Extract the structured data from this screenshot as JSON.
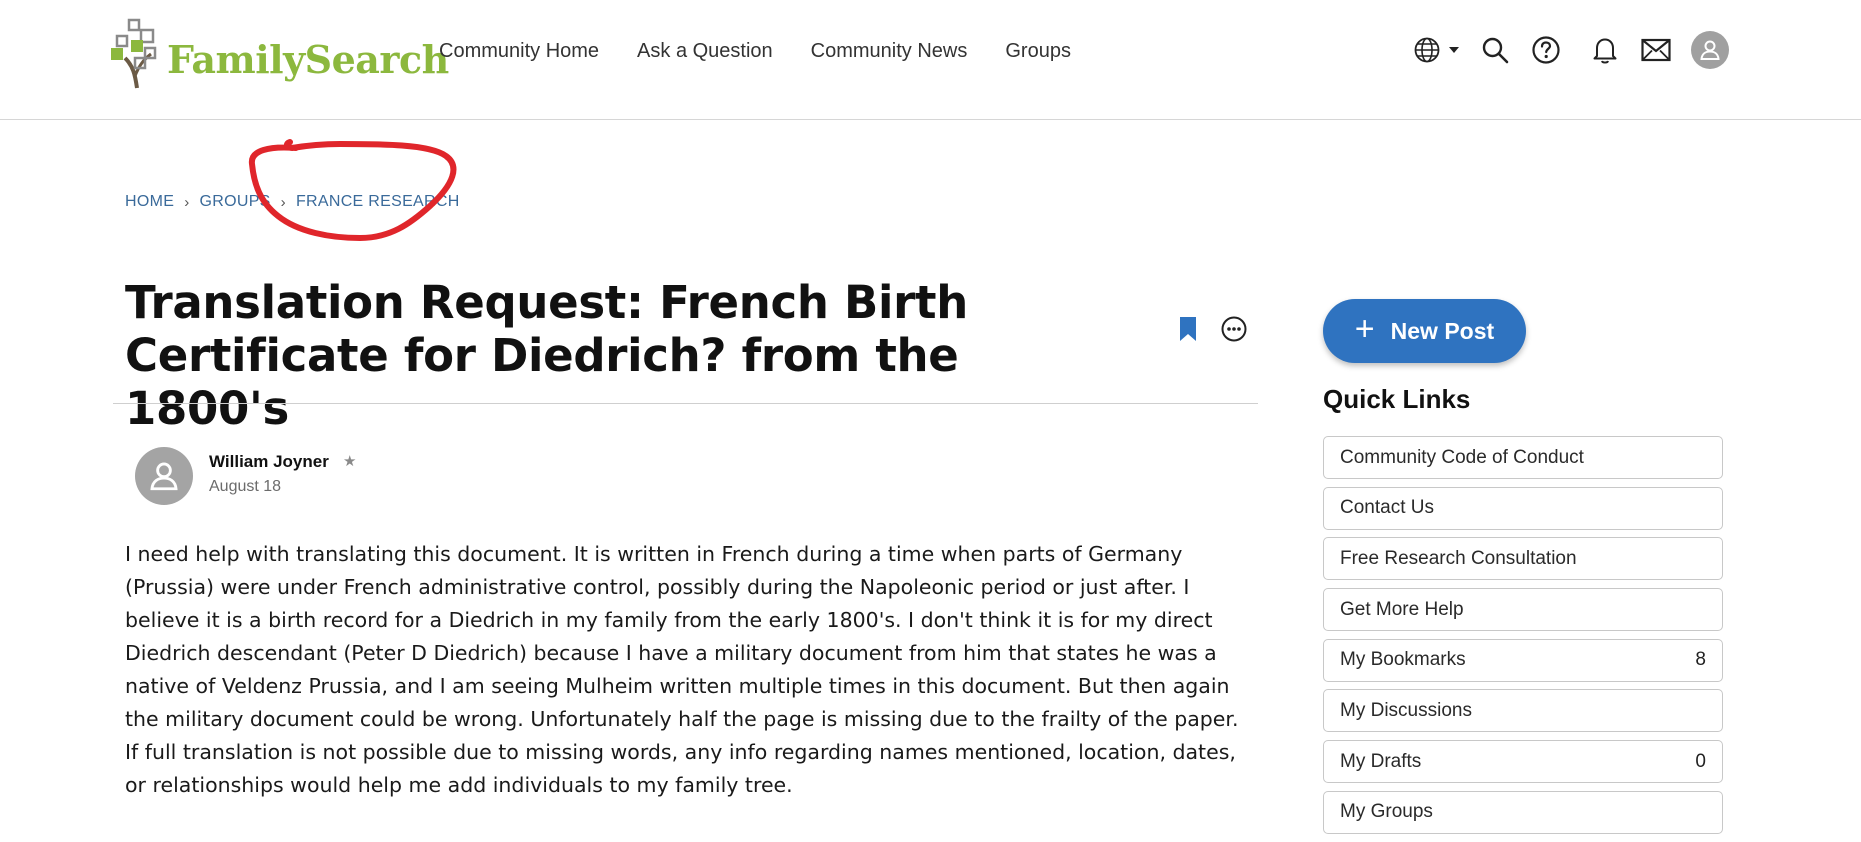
{
  "header": {
    "logo_text": "FamilySearch",
    "nav": [
      "Community Home",
      "Ask a Question",
      "Community News",
      "Groups"
    ],
    "icons": [
      "globe-icon",
      "search-icon",
      "help-icon",
      "bell-icon",
      "mail-icon",
      "user-avatar-icon"
    ]
  },
  "breadcrumb": [
    "HOME",
    "GROUPS",
    "FRANCE RESEARCH"
  ],
  "post": {
    "title": "Translation Request: French Birth Certificate for Diedrich? from the 1800's",
    "author": "William Joyner",
    "date": "August 18",
    "star": "★",
    "body": "I need help with translating this document. It is written in French during a time when parts of Germany (Prussia) were under French administrative control, possibly during the Napoleonic period or just after. I believe it is a birth record for a Diedrich in my family from the early 1800's. I don't think it is for my direct Diedrich descendant (Peter D Diedrich) because I have a military document from him that states he was a native of Veldenz Prussia, and I am seeing Mulheim written multiple times in this document. But then again the military document could be wrong. Unfortunately half the page is missing due to the frailty of the paper. If full translation is not possible due to missing words, any info regarding names mentioned, location, dates, or relationships would help me add individuals to my family tree."
  },
  "sidebar": {
    "new_post_label": "New Post",
    "quick_links_title": "Quick Links",
    "quick_links": [
      {
        "label": "Community Code of Conduct",
        "count": ""
      },
      {
        "label": "Contact Us",
        "count": ""
      },
      {
        "label": "Free Research Consultation",
        "count": ""
      },
      {
        "label": "Get More Help",
        "count": ""
      },
      {
        "label": "My Bookmarks",
        "count": "8"
      },
      {
        "label": "My Discussions",
        "count": ""
      },
      {
        "label": "My Drafts",
        "count": "0"
      },
      {
        "label": "My Groups",
        "count": ""
      }
    ]
  },
  "colors": {
    "brand_green": "#8cb83e",
    "link_blue": "#3a6a9a",
    "button_blue": "#2f73c0",
    "annotation_red": "#e0262b"
  }
}
